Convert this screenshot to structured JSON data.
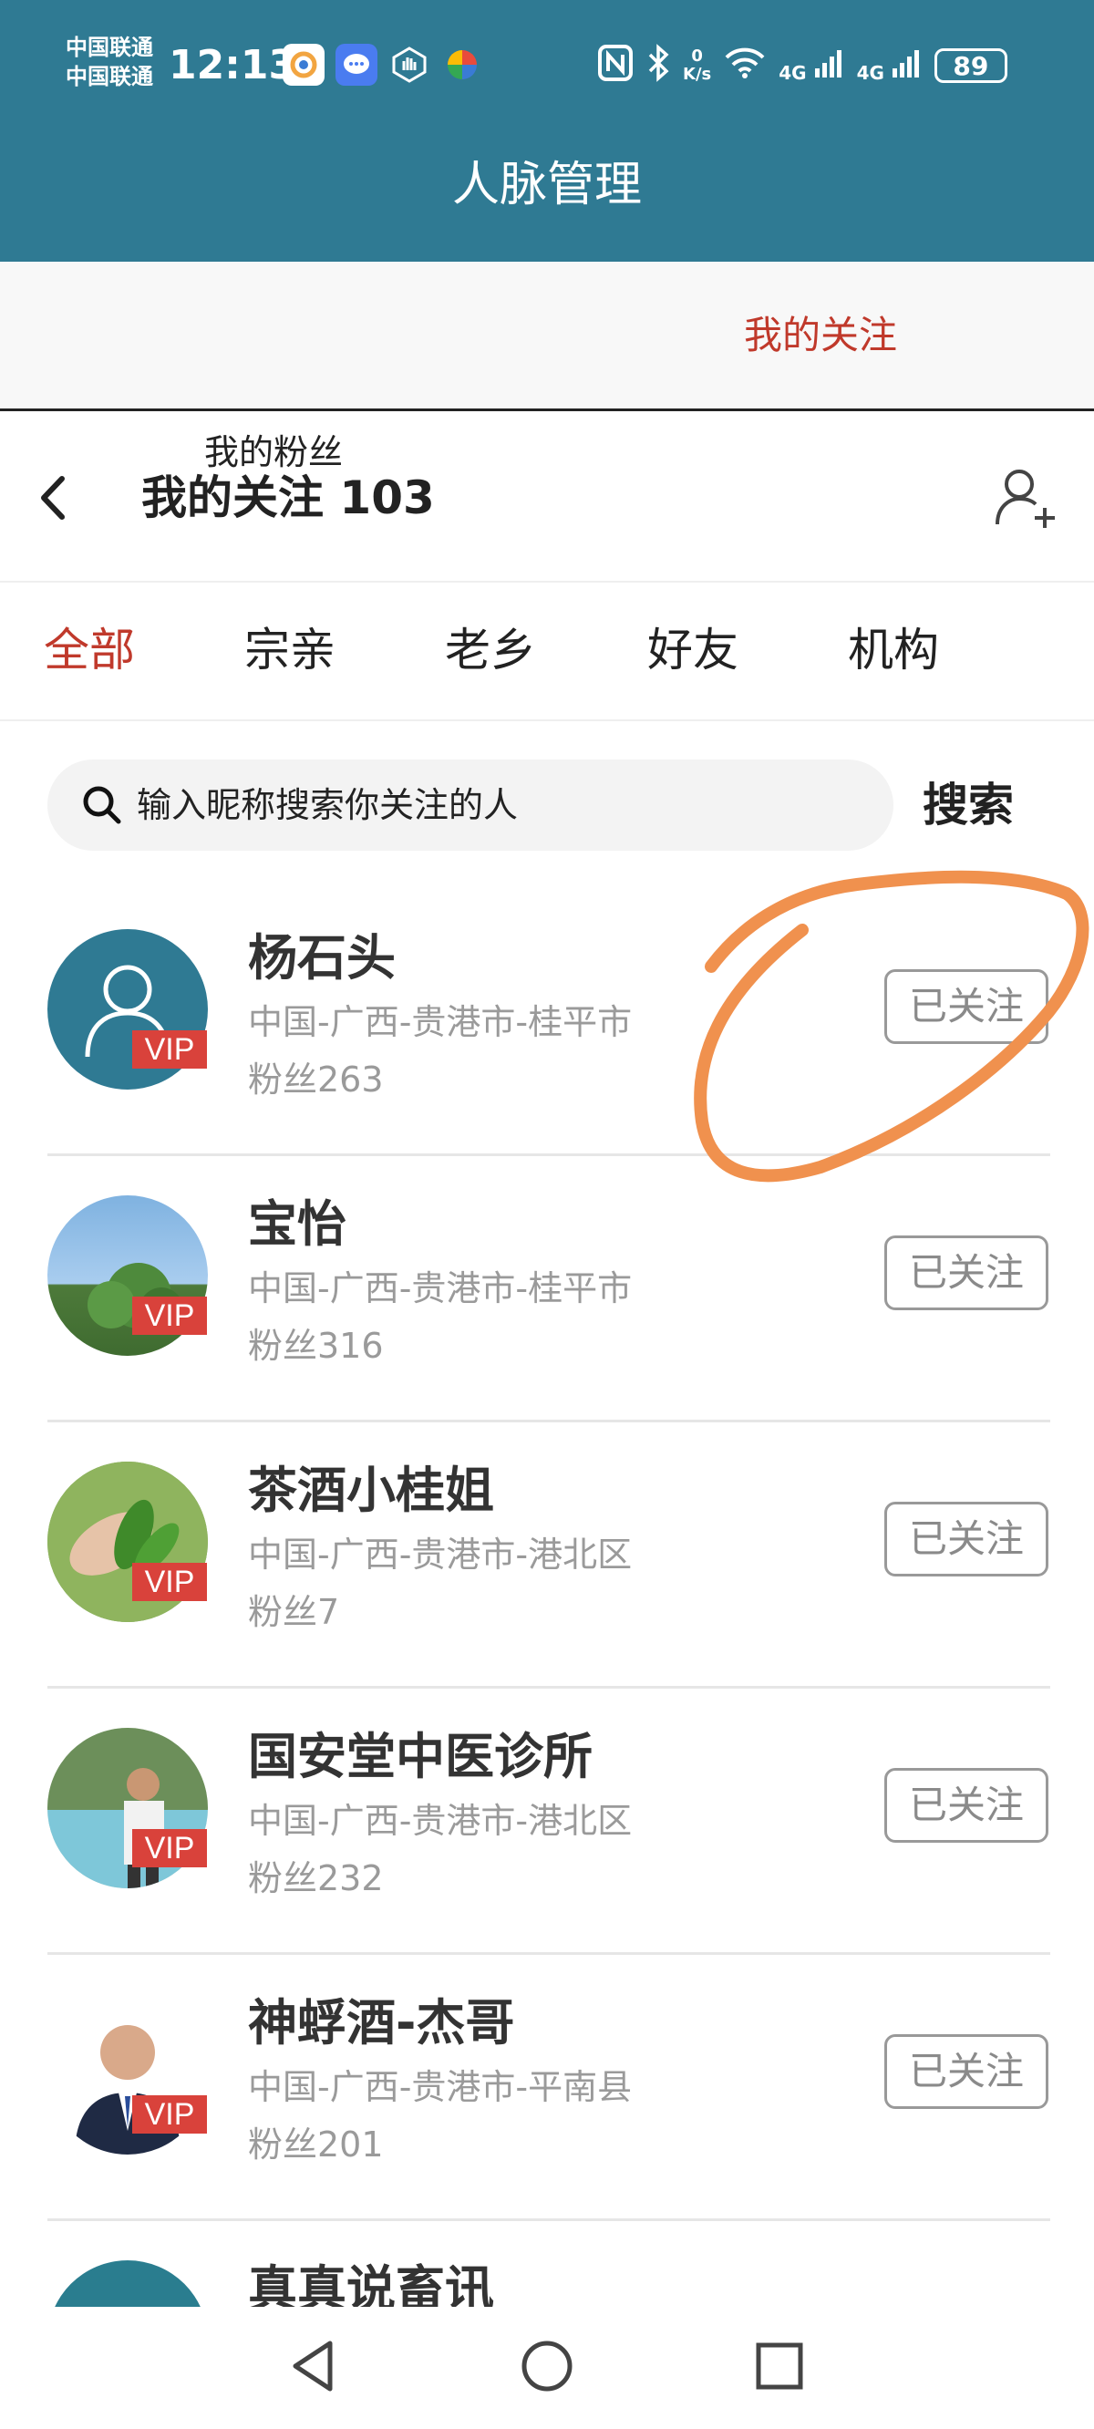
{
  "status_bar": {
    "carrier_1": "中国联通",
    "carrier_2": "中国联通",
    "time": "12:13",
    "net_speed_value": "0",
    "net_speed_unit": "K/s",
    "signal_1": "4G",
    "signal_2": "4G",
    "battery": "89"
  },
  "header": {
    "title": "人脉管理"
  },
  "main_tabs": [
    {
      "label": "我的粉丝",
      "active": false
    },
    {
      "label": "我的关注",
      "active": true
    }
  ],
  "subheader": {
    "title": "我的关注 103"
  },
  "filter_tabs": [
    {
      "label": "全部",
      "active": true
    },
    {
      "label": "宗亲",
      "active": false
    },
    {
      "label": "老乡",
      "active": false
    },
    {
      "label": "好友",
      "active": false
    },
    {
      "label": "机构",
      "active": false
    }
  ],
  "search": {
    "placeholder": "输入昵称搜索你关注的人",
    "button_label": "搜索"
  },
  "list": [
    {
      "name": "杨石头",
      "location": "中国-广西-贵港市-桂平市",
      "fans": "粉丝263",
      "badge": "VIP",
      "button": "已关注"
    },
    {
      "name": "宝怡",
      "location": "中国-广西-贵港市-桂平市",
      "fans": "粉丝316",
      "badge": "VIP",
      "button": "已关注"
    },
    {
      "name": "茶酒小桂姐",
      "location": "中国-广西-贵港市-港北区",
      "fans": "粉丝7",
      "badge": "VIP",
      "button": "已关注"
    },
    {
      "name": "国安堂中医诊所",
      "location": "中国-广西-贵港市-港北区",
      "fans": "粉丝232",
      "badge": "VIP",
      "button": "已关注"
    },
    {
      "name": "神蜉酒-杰哥",
      "location": "中国-广西-贵港市-平南县",
      "fans": "粉丝201",
      "badge": "VIP",
      "button": "已关注"
    },
    {
      "name": "真真说畜讯"
    }
  ],
  "colors": {
    "header_bg": "#2f7a93",
    "accent": "#c0392b",
    "vip": "#d9423b",
    "annotation": "#f0914e"
  },
  "icons": [
    "back-arrow-icon",
    "add-user-icon",
    "search-icon",
    "nav-back-icon",
    "nav-home-icon",
    "nav-recents-icon"
  ]
}
